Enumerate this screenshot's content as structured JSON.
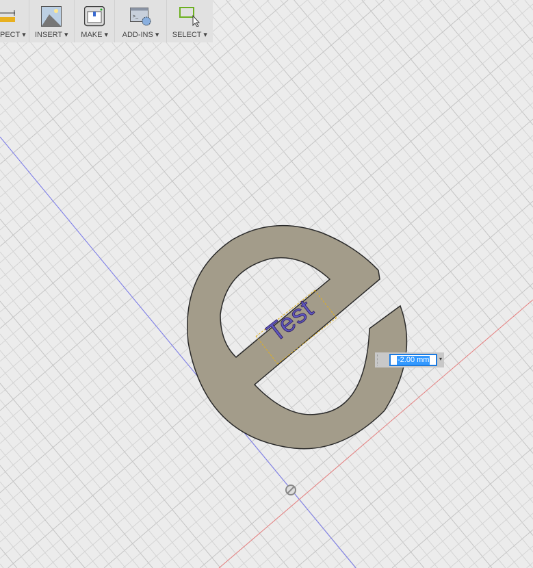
{
  "toolbar": {
    "items": [
      {
        "label": "PECT ▾",
        "icon": "ruler-icon"
      },
      {
        "label": "INSERT ▾",
        "icon": "image-icon"
      },
      {
        "label": "MAKE ▾",
        "icon": "3d-printer-icon"
      },
      {
        "label": "ADD-INS ▾",
        "icon": "scripts-gear-icon"
      },
      {
        "label": "SELECT ▾",
        "icon": "select-box-icon"
      }
    ]
  },
  "model": {
    "text": "Test",
    "fill": "#a39c8a",
    "text_color": "#5e57c0"
  },
  "dimension": {
    "value": "-2.00 mm",
    "dropdown": "▾"
  },
  "axes": {
    "x_color": "#e06060",
    "y_color": "#7070f0"
  }
}
